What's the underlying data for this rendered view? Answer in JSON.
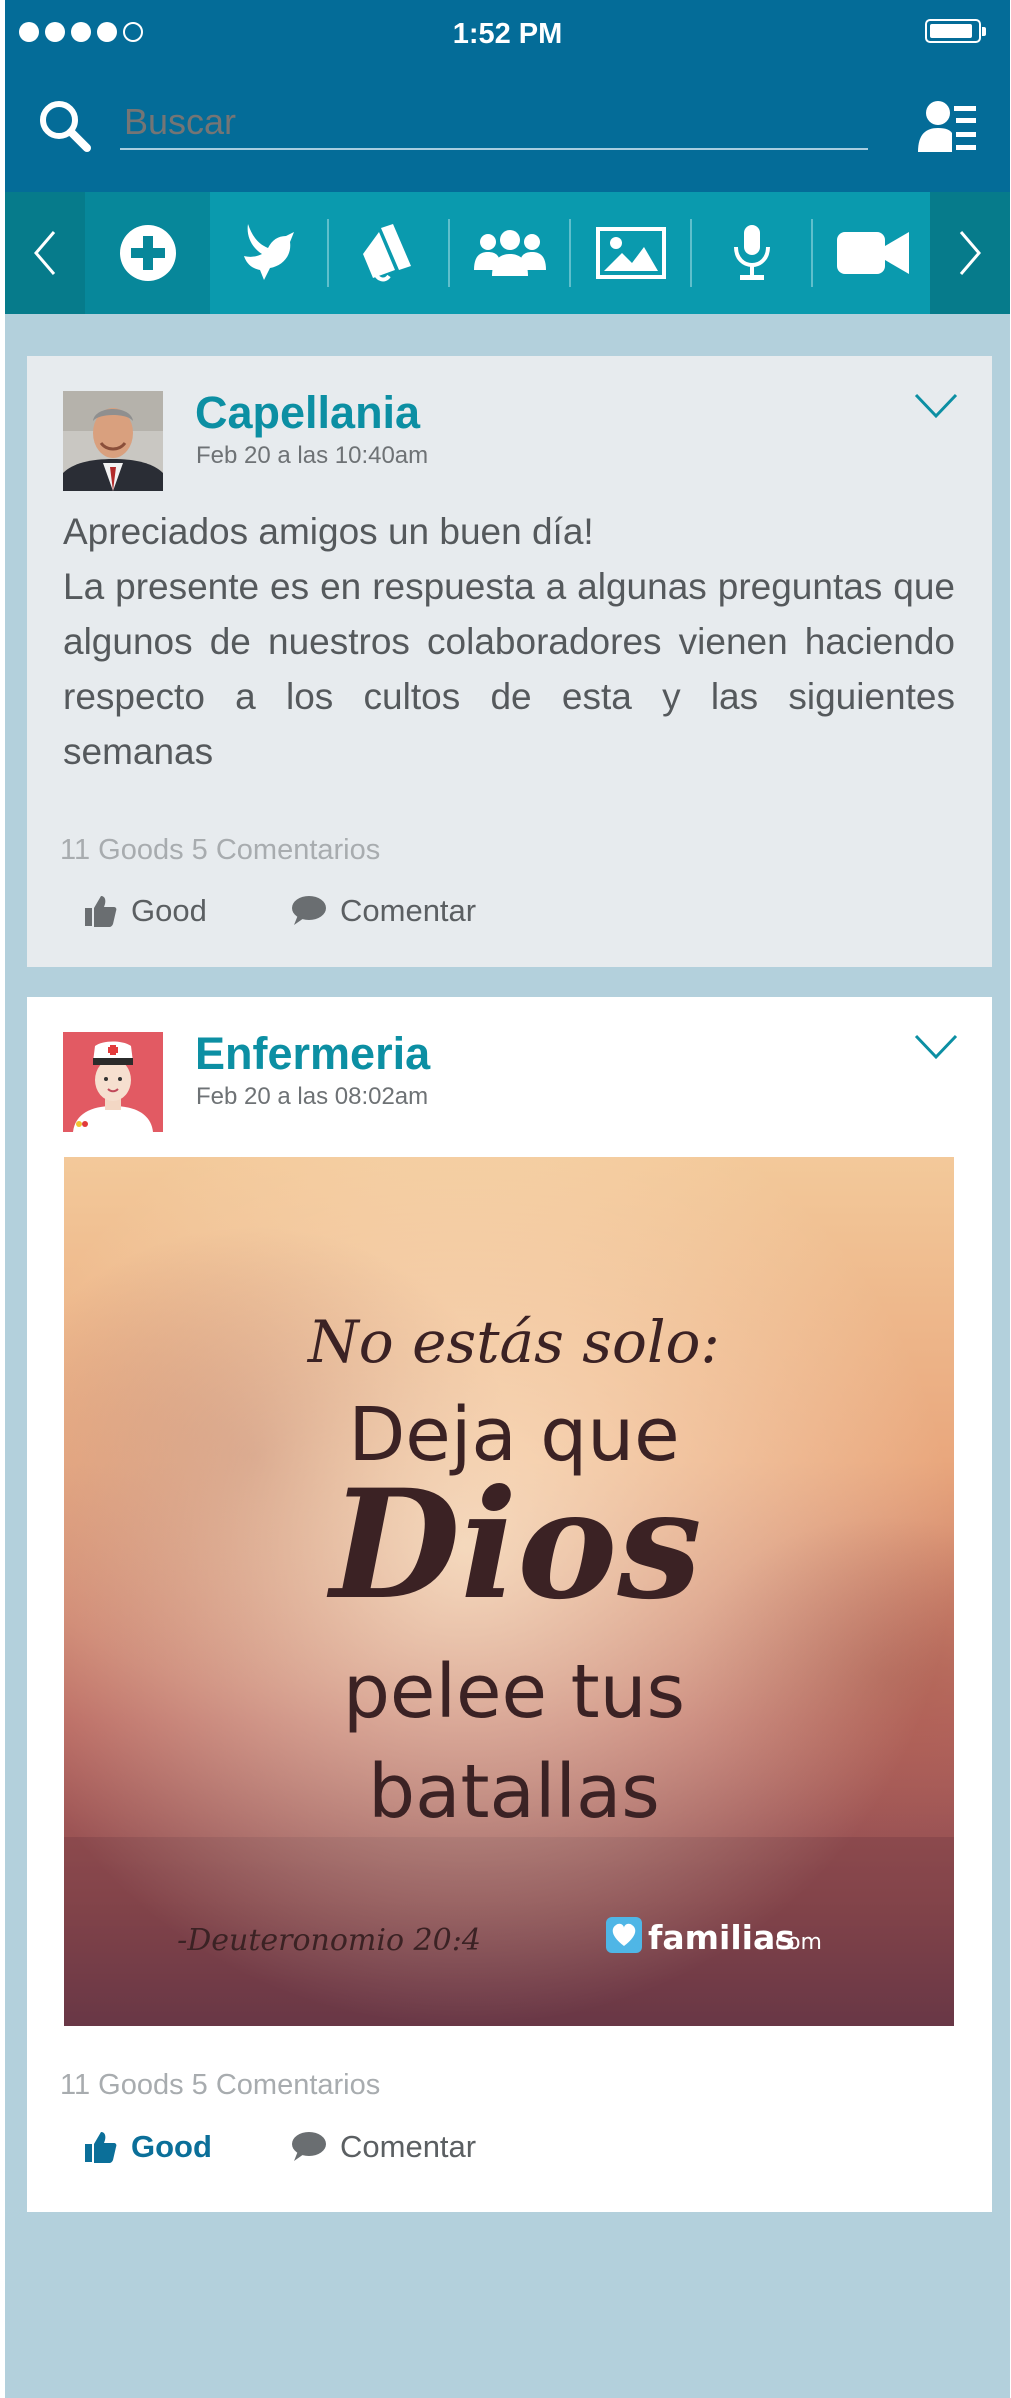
{
  "status_bar": {
    "time": "1:52 PM",
    "signal_dots_filled": 4,
    "signal_dots_total": 5
  },
  "search": {
    "placeholder": "Buscar",
    "icon": "search-icon"
  },
  "toolbar": {
    "icons": [
      "chevron-left-icon",
      "add-icon",
      "dove-icon",
      "megaphone-icon",
      "group-icon",
      "image-icon",
      "microphone-icon",
      "video-camera-icon",
      "chevron-right-icon"
    ]
  },
  "posts": [
    {
      "author": "Capellania",
      "date": "Feb 20 a las 10:40am",
      "text_line1": "Apreciados amigos un buen día!",
      "text_body": "La presente es en respuesta a algunas preguntas que algunos de nuestros colaboradores vienen haciendo respecto a los cultos de esta y las siguientes semanas",
      "stats": "11 Goods  5 Comentarios",
      "good_label": "Good",
      "comment_label": "Comentar",
      "liked": false
    },
    {
      "author": "Enfermeria",
      "date": "Feb 20 a las 08:02am",
      "image": {
        "line1": "No estás solo:",
        "line2": "Deja que",
        "line3": "Dios",
        "line4": "pelee tus",
        "line5": "batallas",
        "citation": "-Deuteronomio 20:4",
        "brand": "familias",
        "brand_suffix": ".com"
      },
      "stats": "11 Goods  5 Comentarios",
      "good_label": "Good",
      "comment_label": "Comentar",
      "liked": true
    }
  ],
  "colors": {
    "header": "#046c98",
    "toolbar": "#0a9aae",
    "accent_teal": "#0c8fa3",
    "liked_blue": "#0b6f99",
    "background": "#b3d0dc"
  }
}
